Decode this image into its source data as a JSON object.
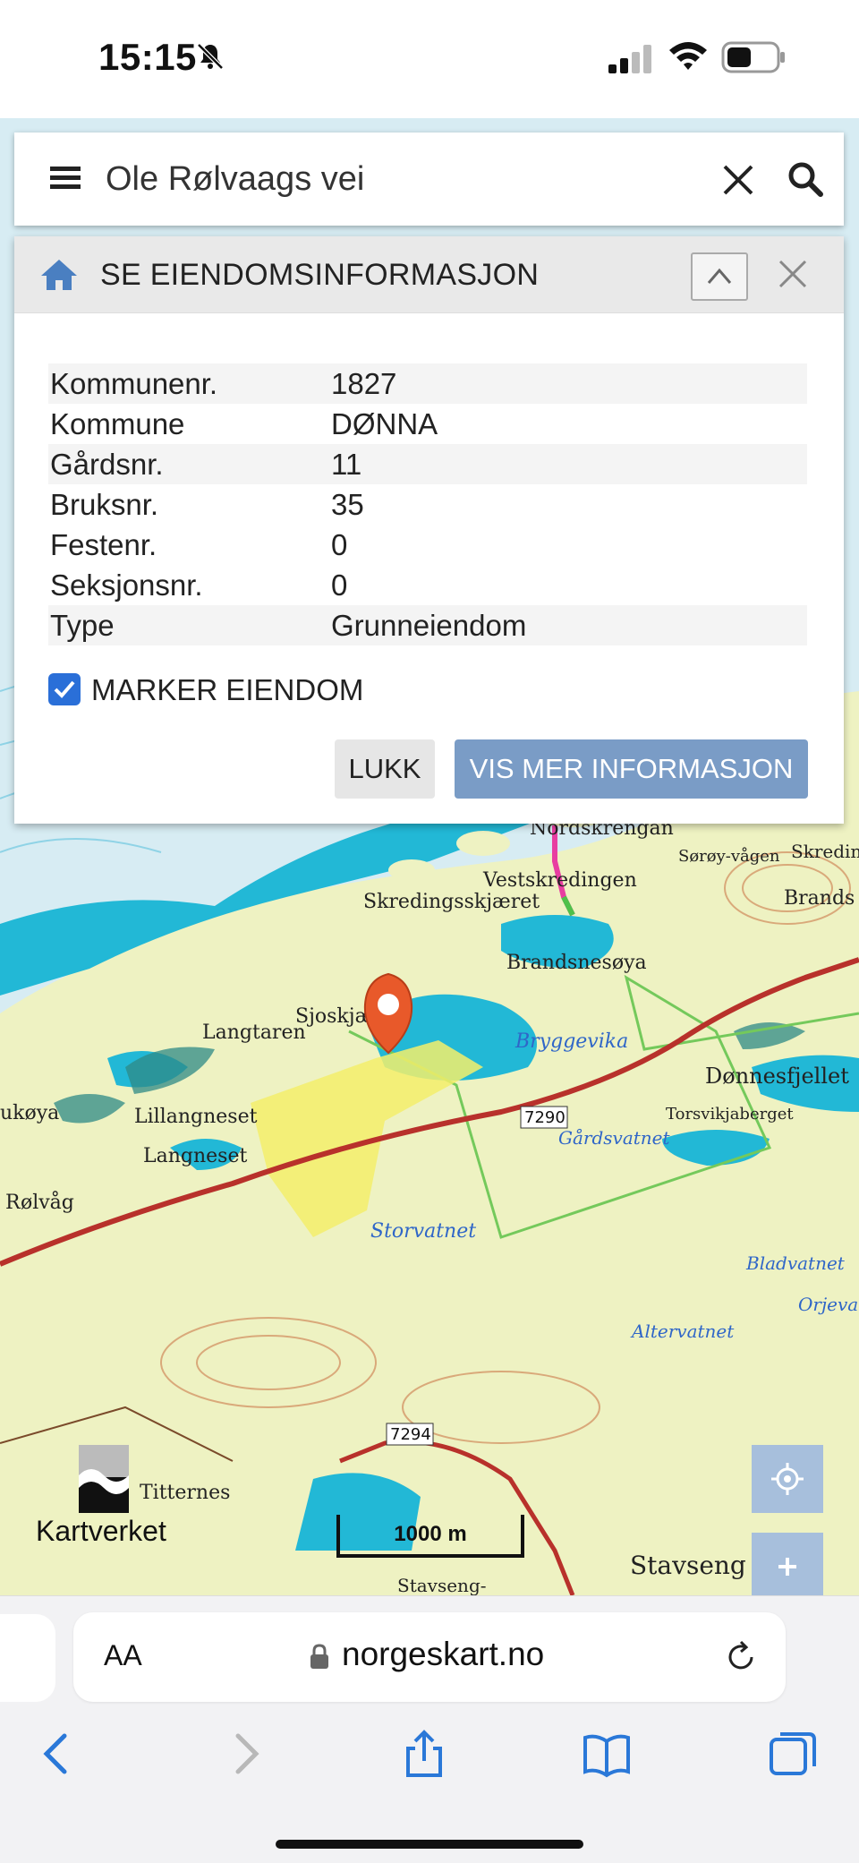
{
  "status": {
    "time": "15:15"
  },
  "search": {
    "value": "Ole Rølvaags vei"
  },
  "panel": {
    "title": "SE EIENDOMSINFORMASJON",
    "rows": [
      {
        "key": "Kommunenr.",
        "value": "1827"
      },
      {
        "key": "Kommune",
        "value": "DØNNA"
      },
      {
        "key": "Gårdsnr.",
        "value": "11"
      },
      {
        "key": "Bruksnr.",
        "value": "35"
      },
      {
        "key": "Festenr.",
        "value": "0"
      },
      {
        "key": "Seksjonsnr.",
        "value": "0"
      },
      {
        "key": "Type",
        "value": "Grunneiendom"
      }
    ],
    "marker_label": "MARKER EIENDOM",
    "marker_checked": true,
    "close_label": "LUKK",
    "more_label": "VIS MER INFORMASJON"
  },
  "map": {
    "place_labels": [
      "Nordskrengan",
      "Vestskredingen",
      "Skredingsskjæret",
      "Brandsnesøya",
      "Sjoskjæret",
      "Langtaren",
      "Bryggevika",
      "Dønnesfjellet",
      "Torsvikjaberget",
      "Gårdsvatnet",
      "Lillangneset",
      "Langneset",
      "Rølvåg",
      "Storvatnet",
      "Bladvatnet",
      "Altervatnet",
      "Titternes",
      "Stavseng",
      "Skredin",
      "Brands nes",
      "Sørøy-vågen",
      "Orjeva",
      "Stavseng-",
      "ukøya",
      "7290",
      "7294"
    ],
    "scale_label": "1000 m",
    "logo_text": "Kartverket"
  },
  "browser": {
    "aa_label": "AA",
    "address": "norgeskart.no"
  },
  "colors": {
    "water": "#22b8d6",
    "shallow": "#d7ecf3",
    "land": "#eef2c2",
    "property": "#f3ef6b",
    "road": "#b8312b",
    "marker": "#e8592a",
    "button_blue": "#7a9cc6",
    "checkbox": "#2a6fd8"
  }
}
